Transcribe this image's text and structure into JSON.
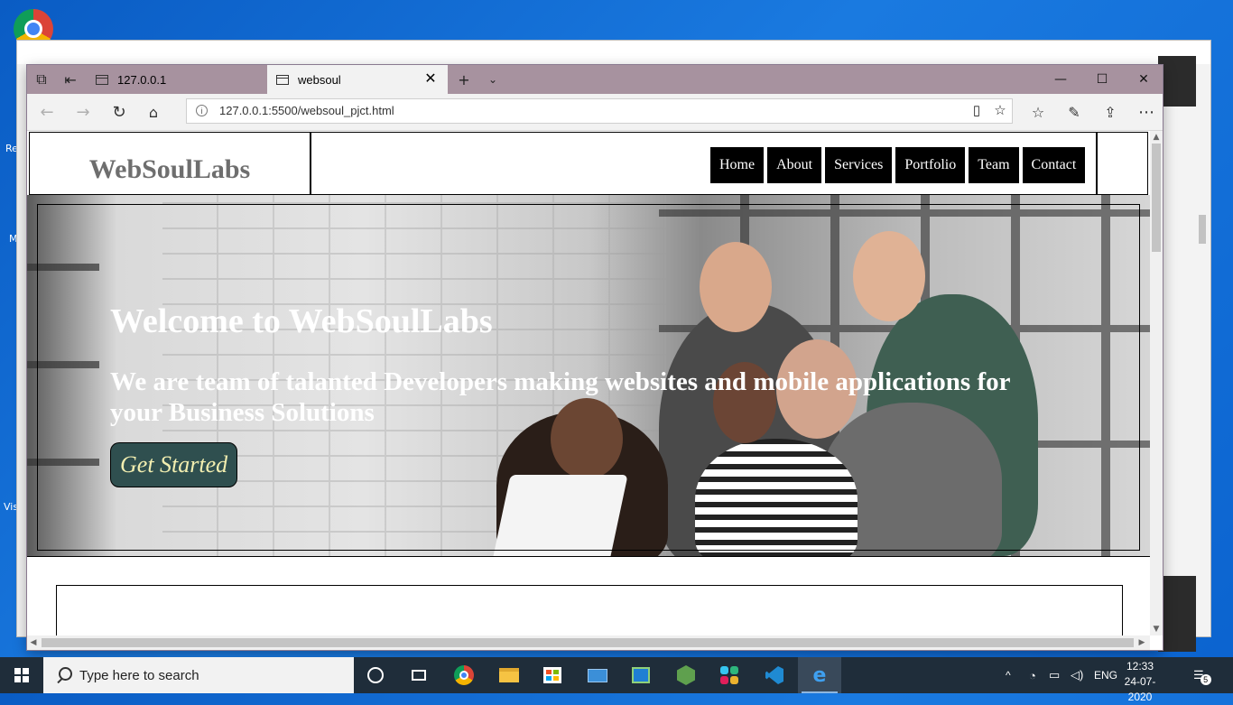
{
  "desktop": {
    "labels": [
      "Re",
      "M",
      "Vis"
    ]
  },
  "browser": {
    "tabs": [
      {
        "title": "127.0.0.1",
        "active": false
      },
      {
        "title": "websoul",
        "active": true
      }
    ],
    "address": "127.0.0.1:5500/websoul_pjct.html",
    "window_controls": {
      "minimize": "—",
      "maximize": "☐",
      "close": "✕"
    }
  },
  "site": {
    "logo": "WebSoulLabs",
    "menu": [
      "Home",
      "About",
      "Services",
      "Portfolio",
      "Team",
      "Contact"
    ],
    "hero": {
      "title": "Welcome to WebSoulLabs",
      "subtitle": "We are team of talanted Developers making websites and mobile applications for your Business Solutions",
      "cta": "Get Started"
    }
  },
  "taskbar": {
    "search_placeholder": "Type here to search",
    "language": "ENG",
    "time": "12:33",
    "date": "24-07-2020",
    "notifications": "5"
  },
  "colors": {
    "tabstrip": "#a7929f",
    "cta_bg": "#2f4f4f",
    "cta_text": "#f2eeb0",
    "taskbar": "#1f2d3a"
  }
}
